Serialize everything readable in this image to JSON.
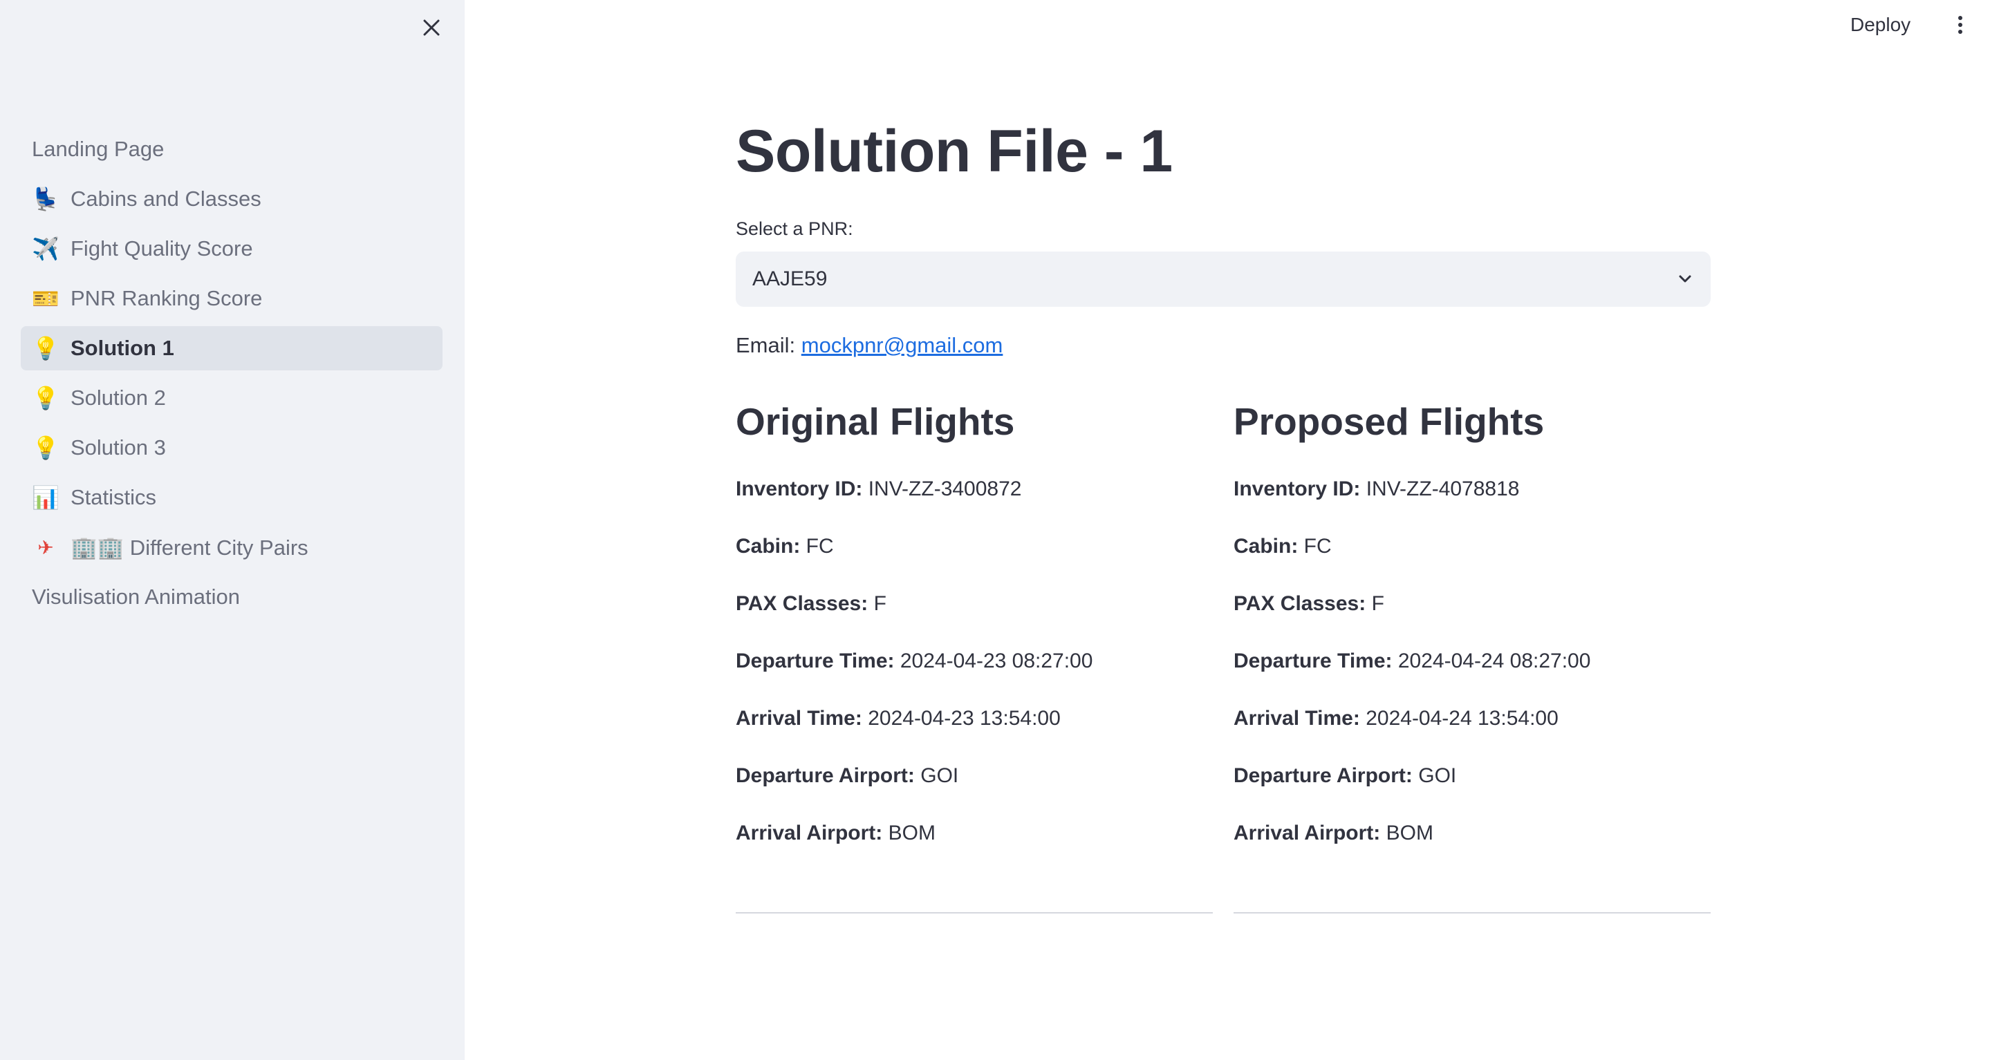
{
  "sidebar": {
    "items": [
      {
        "label": "Landing Page",
        "icon": "",
        "active": false
      },
      {
        "label": "Cabins and Classes",
        "icon": "💺",
        "active": false
      },
      {
        "label": "Fight Quality Score",
        "icon": "✈️",
        "active": false
      },
      {
        "label": "PNR Ranking Score",
        "icon": "🎫",
        "active": false
      },
      {
        "label": "Solution 1",
        "icon": "💡",
        "active": true
      },
      {
        "label": "Solution 2",
        "icon": "💡",
        "active": false
      },
      {
        "label": "Solution 3",
        "icon": "💡",
        "active": false
      },
      {
        "label": "Statistics",
        "icon": "📊",
        "active": false
      },
      {
        "label": "🏢🏢 Different City Pairs",
        "icon": "✈",
        "active": false
      },
      {
        "label": "Visulisation Animation",
        "icon": "",
        "active": false
      }
    ]
  },
  "header": {
    "deploy_label": "Deploy"
  },
  "main": {
    "title": "Solution File - 1",
    "select_label": "Select a PNR:",
    "select_value": "AAJE59",
    "email_label": "Email:",
    "email_value": "mockpnr@gmail.com",
    "original": {
      "heading": "Original Flights",
      "fields": [
        {
          "label": "Inventory ID:",
          "value": "INV-ZZ-3400872"
        },
        {
          "label": "Cabin:",
          "value": "FC"
        },
        {
          "label": "PAX Classes:",
          "value": "F"
        },
        {
          "label": "Departure Time:",
          "value": "2024-04-23 08:27:00"
        },
        {
          "label": "Arrival Time:",
          "value": "2024-04-23 13:54:00"
        },
        {
          "label": "Departure Airport:",
          "value": "GOI"
        },
        {
          "label": "Arrival Airport:",
          "value": "BOM"
        }
      ]
    },
    "proposed": {
      "heading": "Proposed Flights",
      "fields": [
        {
          "label": "Inventory ID:",
          "value": "INV-ZZ-4078818"
        },
        {
          "label": "Cabin:",
          "value": "FC"
        },
        {
          "label": "PAX Classes:",
          "value": "F"
        },
        {
          "label": "Departure Time:",
          "value": "2024-04-24 08:27:00"
        },
        {
          "label": "Arrival Time:",
          "value": "2024-04-24 13:54:00"
        },
        {
          "label": "Departure Airport:",
          "value": "GOI"
        },
        {
          "label": "Arrival Airport:",
          "value": "BOM"
        }
      ]
    }
  },
  "colors": {
    "sidebar_bg": "#f0f2f6",
    "active_item_bg": "#dfe3ea",
    "text": "#31333f",
    "muted_text": "#6b6f7d",
    "link": "#1c6ce0",
    "divider": "#d6d8de"
  }
}
